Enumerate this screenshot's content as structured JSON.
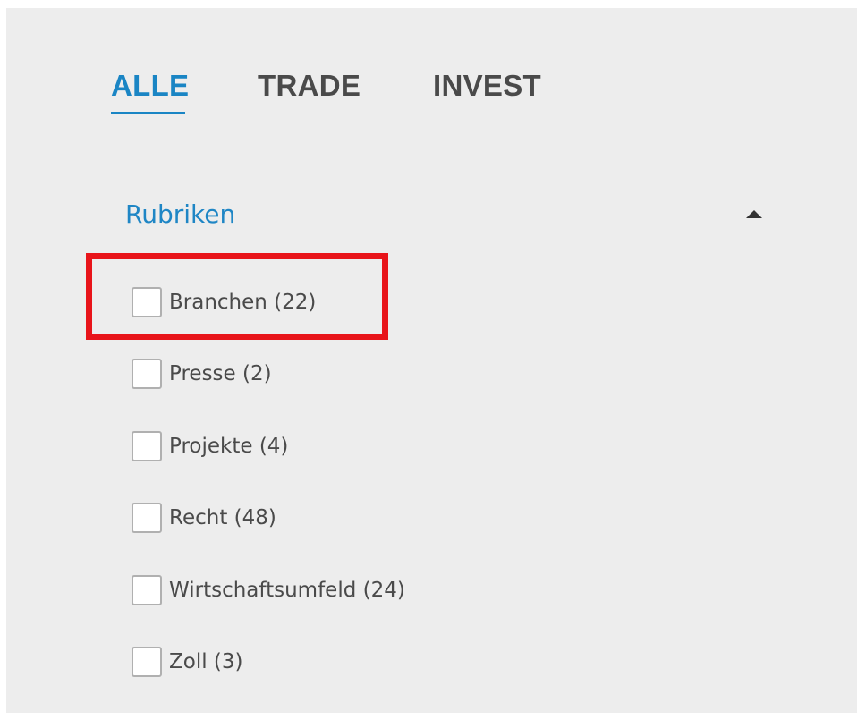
{
  "tabs": [
    {
      "label": "ALLE",
      "active": true
    },
    {
      "label": "TRADE",
      "active": false
    },
    {
      "label": "INVEST",
      "active": false
    }
  ],
  "filter_section": {
    "title": "Rubriken",
    "expanded": true,
    "options": [
      {
        "label": "Branchen (22)",
        "checked": false
      },
      {
        "label": "Presse (2)",
        "checked": false
      },
      {
        "label": "Projekte (4)",
        "checked": false
      },
      {
        "label": "Recht (48)",
        "checked": false
      },
      {
        "label": "Wirtschaftsumfeld (24)",
        "checked": false
      },
      {
        "label": "Zoll (3)",
        "checked": false
      }
    ]
  },
  "colors": {
    "accent": "#1a85c4",
    "highlight": "#e8141a",
    "panel_background": "#ededed",
    "text": "#4a4a4a"
  }
}
